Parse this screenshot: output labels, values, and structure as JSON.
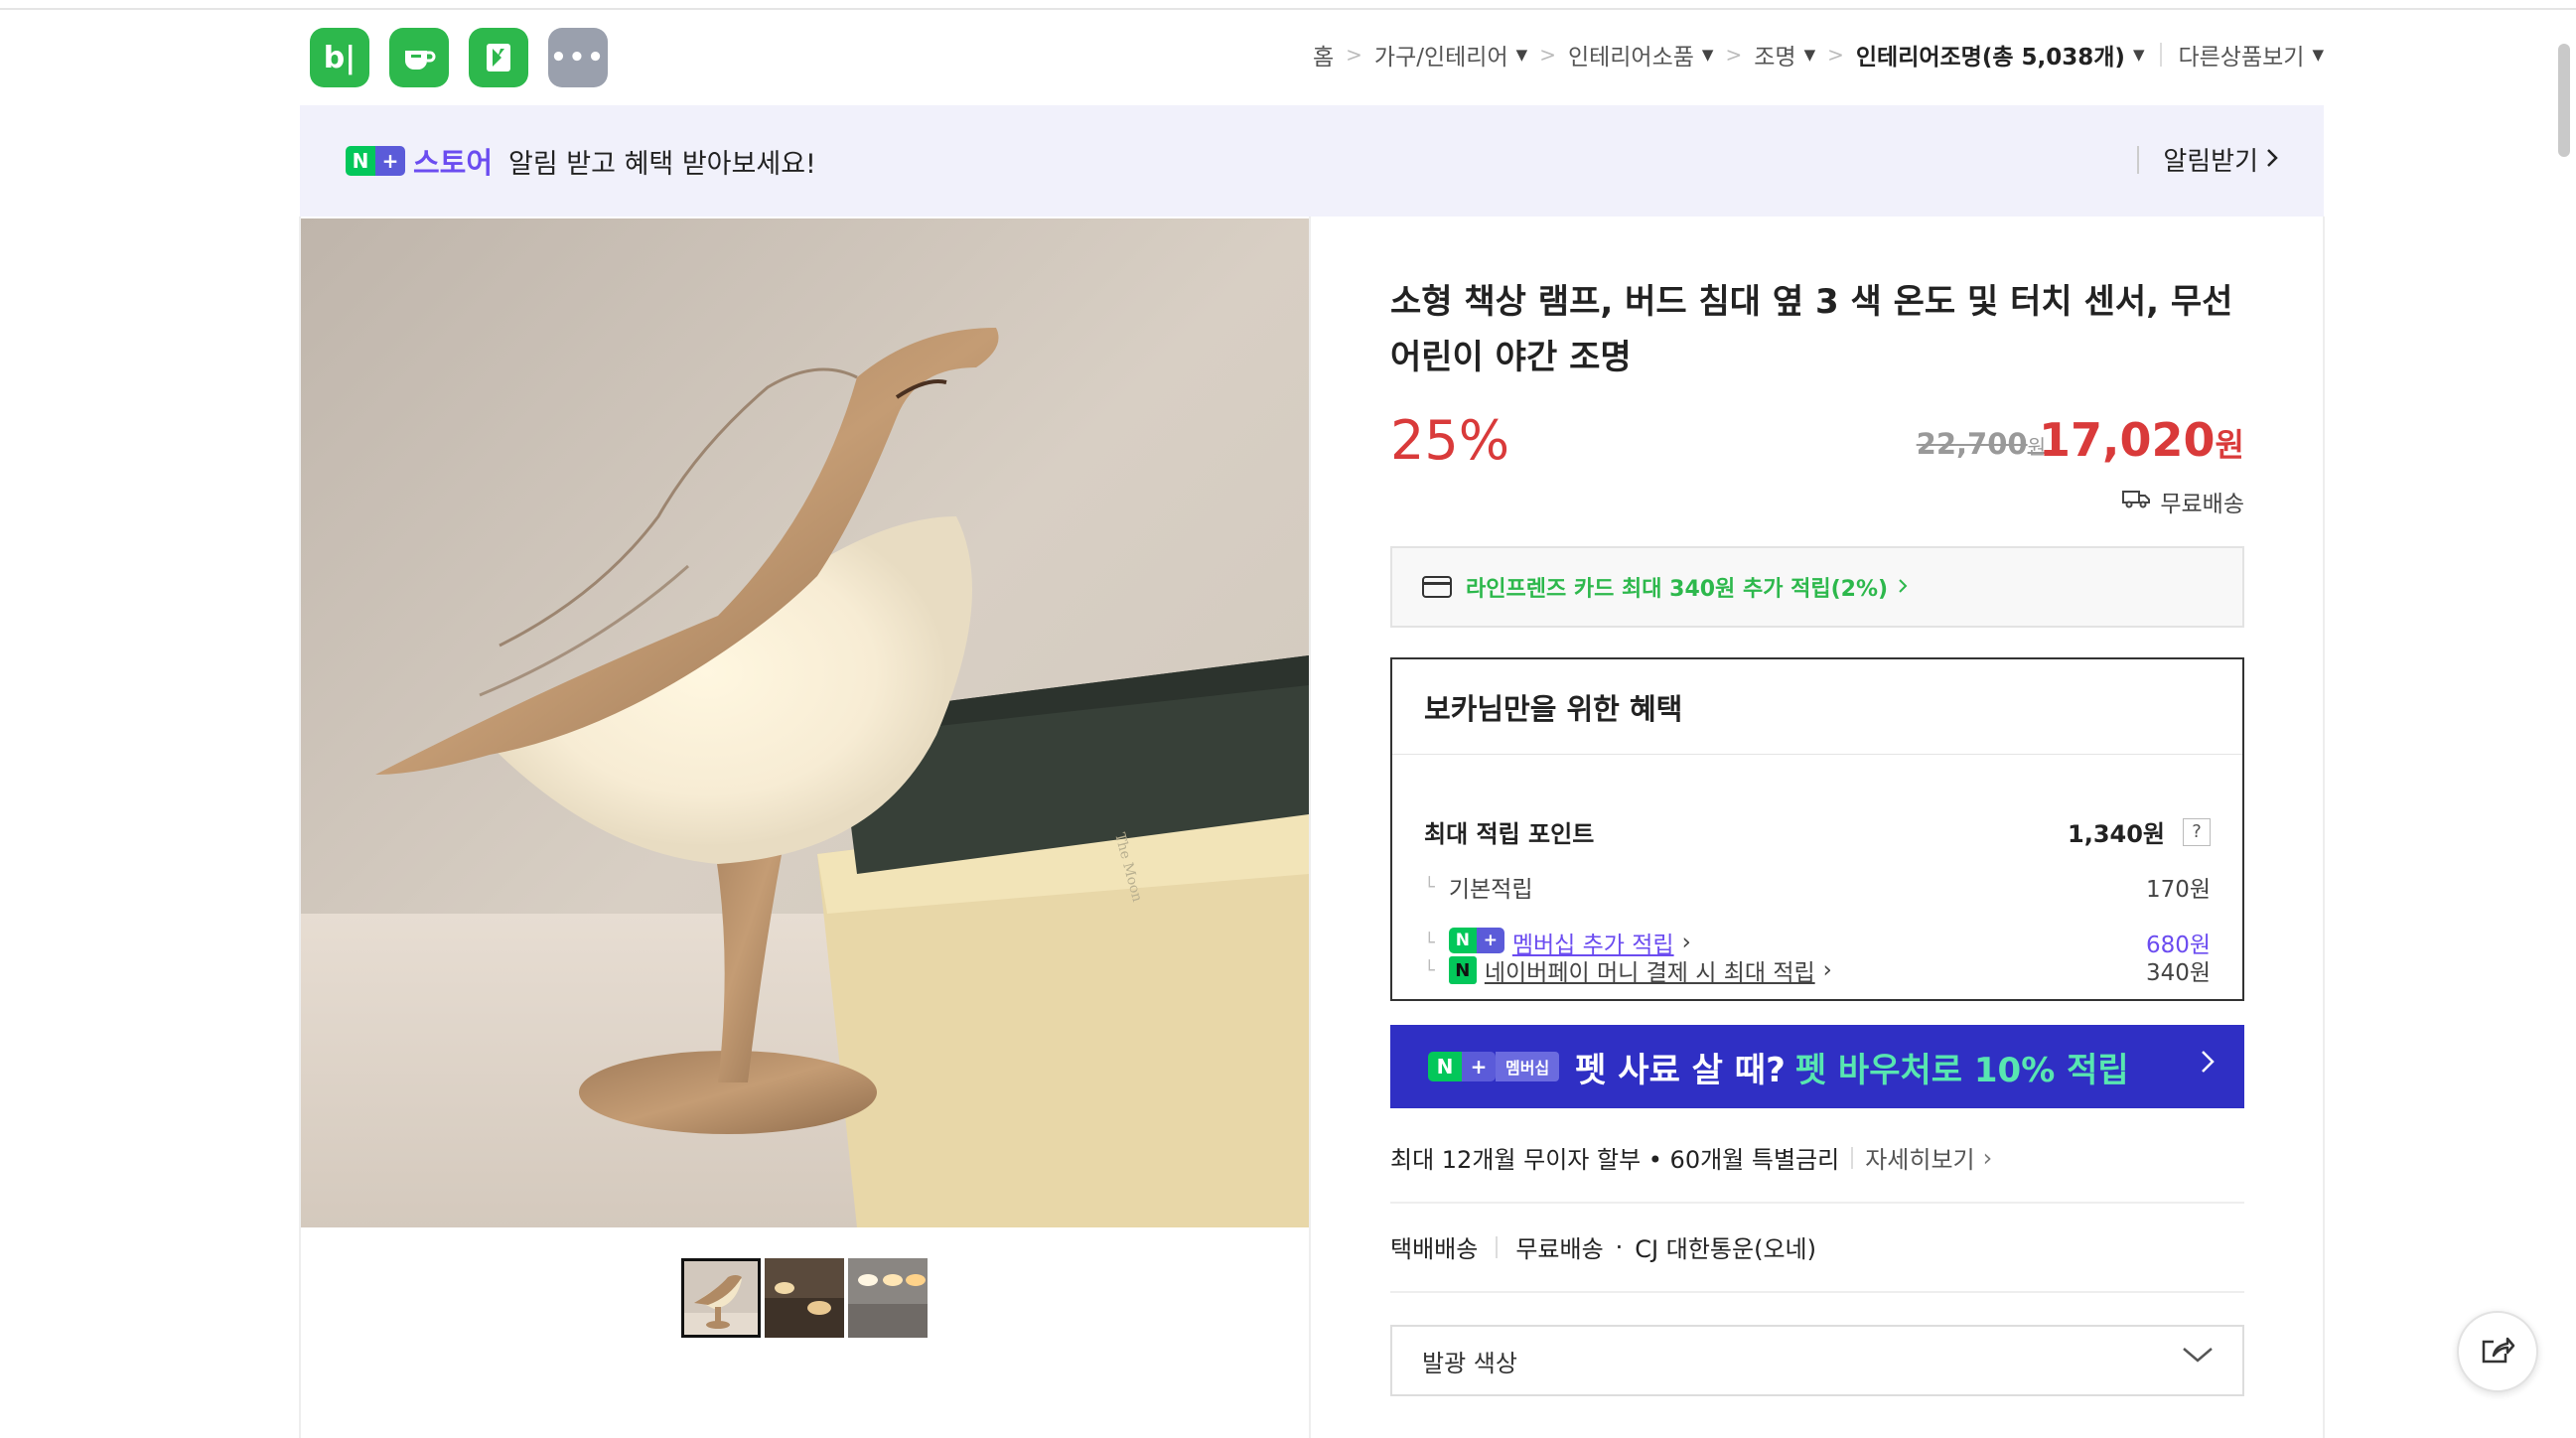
{
  "header": {
    "apps": [
      {
        "icon": "blog-icon",
        "glyph": "b|"
      },
      {
        "icon": "cafe-icon",
        "glyph": "☕"
      },
      {
        "icon": "bookmark-icon",
        "glyph": "▶"
      },
      {
        "icon": "more-icon",
        "glyph": "•••"
      }
    ],
    "breadcrumb": {
      "home": "홈",
      "level1": "가구/인테리어",
      "level2": "인테리어소품",
      "level3": "조명",
      "current": "인테리어조명(총 5,038개)",
      "other": "다른상품보기"
    }
  },
  "banner": {
    "n_badge": "N",
    "plus_badge": "+",
    "store_label": "스토어",
    "text": "알림 받고 혜택 받아보세요!",
    "alarm_label": "알림받기"
  },
  "product": {
    "title": "소형 책상 램프, 버드 침대 옆 3 색 온도 및 터치 센서, 무선 어린이 야간 조명",
    "discount": "25%",
    "original_price": "22,700",
    "original_unit": "원",
    "sale_price": "17,020",
    "sale_unit": "원",
    "shipping": "무료배송",
    "card_offer": "라인프렌즈 카드 최대 340원 추가 적립(2%)"
  },
  "benefit": {
    "title": "보카님만을 위한 혜택",
    "max_points_label": "최대 적립 포인트",
    "max_points_value": "1,340원",
    "help": "?",
    "rows": [
      {
        "label": "기본적립",
        "value": "170원"
      },
      {
        "label": "멤버십 추가 적립",
        "value": "680원"
      },
      {
        "label": "네이버페이 머니 결제 시 최대 적립",
        "value": "340원"
      }
    ]
  },
  "promo": {
    "membership": "멤버십",
    "text1": "펫 사료 살 때?",
    "text2": "펫 바우처로 10% 적립"
  },
  "installment": {
    "text": "최대 12개월 무이자 할부 • 60개월 특별금리",
    "detail": "자세히보기"
  },
  "delivery": {
    "type": "택배배송",
    "fee": "무료배송",
    "courier": "CJ 대한통운(오네)"
  },
  "option": {
    "placeholder": "발광 색상"
  },
  "colors": {
    "price_red": "#d93a3a",
    "naver_green": "#03c75a",
    "promo_blue": "#2f2fc4",
    "store_purple": "#6b4cf0"
  }
}
